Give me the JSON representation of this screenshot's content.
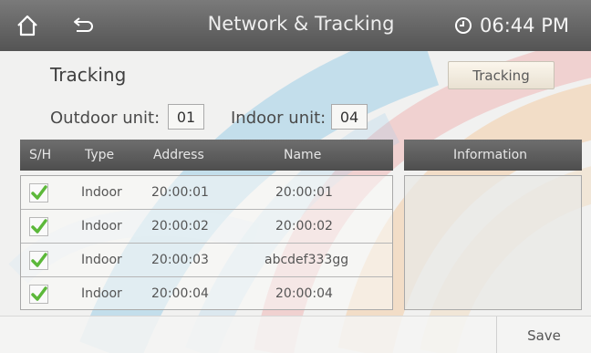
{
  "header": {
    "title": "Network & Tracking",
    "time": "06:44 PM",
    "home_icon": "home-icon",
    "back_icon": "back-arrow-icon",
    "clock_icon": "clock-icon"
  },
  "section_title": "Tracking",
  "tracking_button": "Tracking",
  "outdoor_unit": {
    "label": "Outdoor unit:",
    "value": "01"
  },
  "indoor_unit": {
    "label": "Indoor unit:",
    "value": "04"
  },
  "table": {
    "headers": [
      "S/H",
      "Type",
      "Address",
      "Name"
    ],
    "rows": [
      {
        "checked": true,
        "type": "Indoor",
        "address": "20:00:01",
        "name": "20:00:01"
      },
      {
        "checked": true,
        "type": "Indoor",
        "address": "20:00:02",
        "name": "20:00:02"
      },
      {
        "checked": true,
        "type": "Indoor",
        "address": "20:00:03",
        "name": "abcdef333gg"
      },
      {
        "checked": true,
        "type": "Indoor",
        "address": "20:00:04",
        "name": "20:00:04"
      }
    ]
  },
  "information": {
    "header": "Information"
  },
  "save_button": "Save",
  "colors": {
    "header_bg": "#5e5e5e",
    "check_green": "#5cb83a",
    "swoosh_blue": "#5ab4e0",
    "swoosh_orange": "#f6a54a",
    "swoosh_red": "#ec5f5f"
  }
}
